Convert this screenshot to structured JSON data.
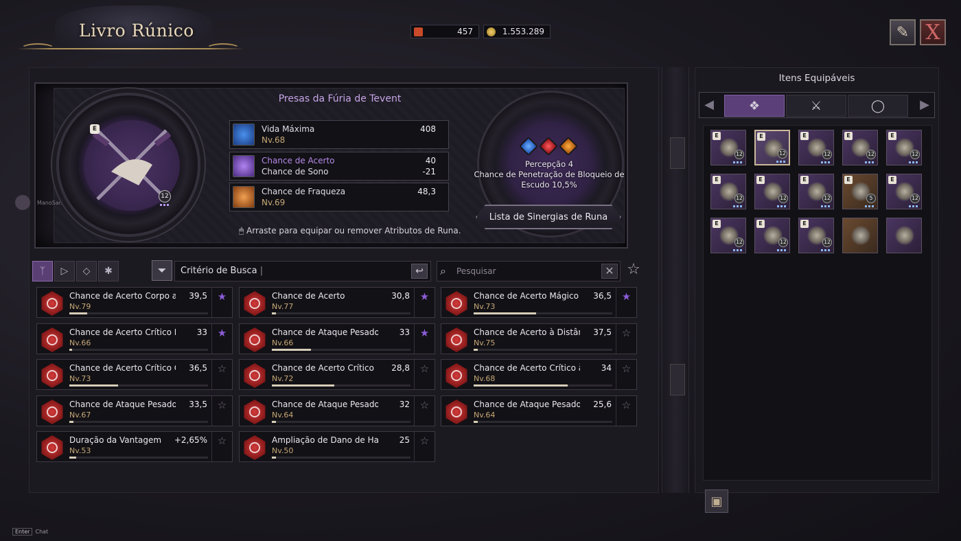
{
  "header": {
    "title": "Livro Rúnico",
    "currency1": "457",
    "currency2": "1.553.289",
    "book_icon": "book-quill-icon",
    "close_label": "X"
  },
  "rune": {
    "name": "Presas da Fúria de Tevent",
    "level_badge": "12",
    "e_badge": "E",
    "stats": [
      {
        "line1": "Vida Máxima",
        "line2": "Nv.68",
        "value1": "408",
        "value2": "",
        "icon_color": "#2a6fd8"
      },
      {
        "line1": "Chance de Acerto",
        "line2": "Chance de Sono",
        "value1": "40",
        "value2": "-21",
        "icon_color": "#8a4ed0"
      },
      {
        "line1": "Chance de Fraqueza",
        "line2": "Nv.69",
        "value1": "48,3",
        "value2": "",
        "icon_color": "#d86a1e"
      }
    ],
    "synergy_line1": "Percepção 4",
    "synergy_line2": "Chance de Penetração de Bloqueio de Escudo 10,5%",
    "synergy_button": "Lista de Sinergias de Runa",
    "hint": "Arraste para equipar ou remover Atributos de Runa.",
    "gems": [
      "#2a6fd8",
      "#c81e2a",
      "#e07a10"
    ]
  },
  "player": {
    "name": "ManoSamm"
  },
  "filter": {
    "criteria_label": "Critério de Busca",
    "search_placeholder": "Pesquisar",
    "tabs": [
      "ᛉ",
      "▷",
      "◇",
      "✱"
    ]
  },
  "runes": [
    {
      "name": "Chance de Acerto Corpo a C",
      "value": "39,5",
      "level": "Nv.79",
      "progress": 0.13,
      "fav": true
    },
    {
      "name": "Chance de Acerto",
      "value": "30,8",
      "level": "Nv.77",
      "progress": 0.03,
      "fav": true
    },
    {
      "name": "Chance de Acerto Mágico",
      "value": "36,5",
      "level": "Nv.73",
      "progress": 0.45,
      "fav": true
    },
    {
      "name": "Chance de Acerto Crítico Má",
      "value": "33",
      "level": "Nv.66",
      "progress": 0.02,
      "fav": true
    },
    {
      "name": "Chance de Ataque Pesado M",
      "value": "33",
      "level": "Nv.66",
      "progress": 0.28,
      "fav": true
    },
    {
      "name": "Chance de Acerto à Distânci",
      "value": "37,5",
      "level": "Nv.75",
      "progress": 0.03,
      "fav": false
    },
    {
      "name": "Chance de Acerto Crítico Co",
      "value": "36,5",
      "level": "Nv.73",
      "progress": 0.35,
      "fav": false
    },
    {
      "name": "Chance de Acerto Crítico",
      "value": "28,8",
      "level": "Nv.72",
      "progress": 0.45,
      "fav": false
    },
    {
      "name": "Chance de Acerto Crítico à D",
      "value": "34",
      "level": "Nv.68",
      "progress": 0.68,
      "fav": false
    },
    {
      "name": "Chance de Ataque Pesado Co",
      "value": "33,5",
      "level": "Nv.67",
      "progress": 0.03,
      "fav": false
    },
    {
      "name": "Chance de Ataque Pesado à",
      "value": "32",
      "level": "Nv.64",
      "progress": 0.03,
      "fav": false
    },
    {
      "name": "Chance de Ataque Pesado",
      "value": "25,6",
      "level": "Nv.64",
      "progress": 0.03,
      "fav": false
    },
    {
      "name": "Duração da Vantagem",
      "value": "+2,65%",
      "level": "Nv.53",
      "progress": 0.05,
      "fav": false
    },
    {
      "name": "Ampliação de Dano de Habili",
      "value": "25",
      "level": "Nv.50",
      "progress": 0.03,
      "fav": false
    }
  ],
  "equip": {
    "title": "Itens Equipáveis",
    "categories": [
      "❖",
      "⚔",
      "◯"
    ],
    "items": [
      {
        "badge": "E",
        "level": "12"
      },
      {
        "badge": "E",
        "level": "12"
      },
      {
        "badge": "E",
        "level": "12"
      },
      {
        "badge": "E",
        "level": "12"
      },
      {
        "badge": "E",
        "level": "12"
      },
      {
        "badge": "E",
        "level": "12"
      },
      {
        "badge": "E",
        "level": "12"
      },
      {
        "badge": "E",
        "level": "12"
      },
      {
        "badge": "E",
        "level": "5"
      },
      {
        "badge": "E",
        "level": "12"
      },
      {
        "badge": "E",
        "level": "12"
      },
      {
        "badge": "E",
        "level": "12"
      },
      {
        "badge": "E",
        "level": "12"
      },
      {
        "badge": "",
        "level": ""
      },
      {
        "badge": "",
        "level": ""
      }
    ]
  },
  "chat": {
    "key": "Enter",
    "label": "Chat"
  }
}
